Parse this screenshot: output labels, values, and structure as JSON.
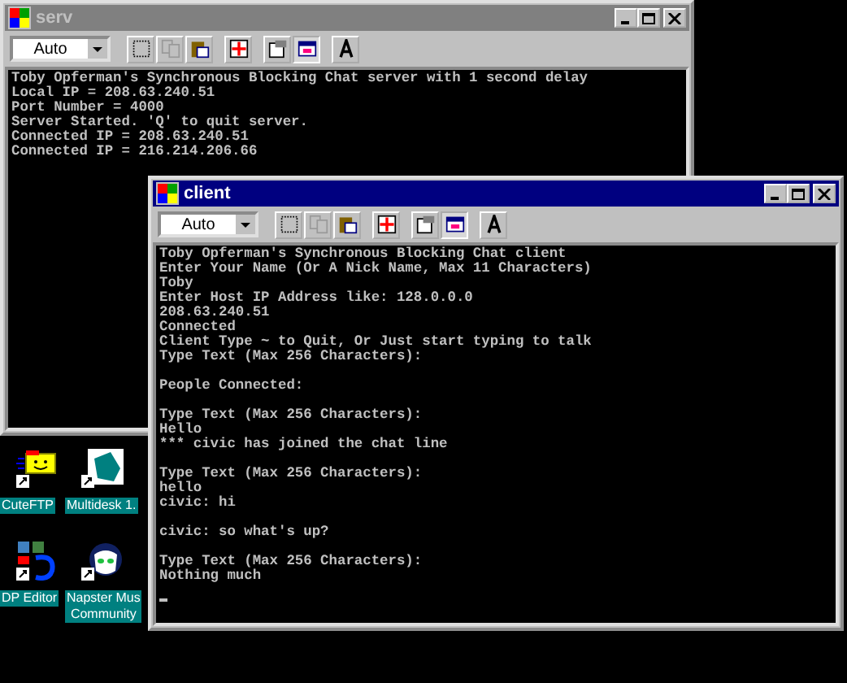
{
  "desktop_icons": [
    {
      "label_lines": [
        "CuteFTP"
      ],
      "kind": "ftp"
    },
    {
      "label_lines": [
        "Multidesk 1."
      ],
      "kind": "multidesk"
    },
    {
      "label_lines": [
        "DP Editor"
      ],
      "kind": "editor"
    },
    {
      "label_lines": [
        "Napster Mus",
        "Community"
      ],
      "kind": "napster"
    }
  ],
  "windows": [
    {
      "title": "serv",
      "active": false,
      "font_dropdown": "Auto",
      "tools": [
        {
          "kind": "mark",
          "disabled": false,
          "pressed": false
        },
        {
          "kind": "copy",
          "disabled": true,
          "pressed": false
        },
        {
          "kind": "paste",
          "disabled": false,
          "pressed": false
        },
        {
          "kind": "fullscreen",
          "disabled": false,
          "pressed": false
        },
        {
          "kind": "properties",
          "disabled": false,
          "pressed": false
        },
        {
          "kind": "background",
          "disabled": false,
          "pressed": true
        },
        {
          "kind": "font",
          "disabled": false,
          "pressed": false
        }
      ],
      "console_blocks": [
        [
          "Toby Opferman's Synchronous Blocking Chat server with 1 second delay",
          "Local IP = 208.63.240.51",
          "Port Number = 4000",
          "Server Started. 'Q' to quit server.",
          "Connected IP = 208.63.240.51",
          "Connected IP = 216.214.206.66"
        ]
      ],
      "cursor": false
    },
    {
      "title": "client",
      "active": true,
      "font_dropdown": "Auto",
      "tools": [
        {
          "kind": "mark",
          "disabled": false,
          "pressed": false
        },
        {
          "kind": "copy",
          "disabled": true,
          "pressed": false
        },
        {
          "kind": "paste",
          "disabled": false,
          "pressed": false
        },
        {
          "kind": "fullscreen",
          "disabled": false,
          "pressed": false
        },
        {
          "kind": "properties",
          "disabled": false,
          "pressed": false
        },
        {
          "kind": "background",
          "disabled": false,
          "pressed": true
        },
        {
          "kind": "font",
          "disabled": false,
          "pressed": false
        }
      ],
      "console_blocks": [
        [
          "Toby Opferman's Synchronous Blocking Chat client",
          "Enter Your Name (Or A Nick Name, Max 11 Characters)",
          "Toby",
          "Enter Host IP Address like: 128.0.0.0",
          "208.63.240.51",
          "Connected",
          "Client Type ~ to Quit, Or Just start typing to talk",
          "Type Text (Max 256 Characters):"
        ],
        [
          "People Connected:"
        ],
        [
          "Type Text (Max 256 Characters):",
          "Hello",
          "*** civic has joined the chat line"
        ],
        [
          "Type Text (Max 256 Characters):",
          "hello",
          "civic: hi"
        ],
        [
          "civic: so what's up?"
        ],
        [
          "Type Text (Max 256 Characters):",
          "Nothing much"
        ]
      ],
      "cursor": true
    }
  ]
}
